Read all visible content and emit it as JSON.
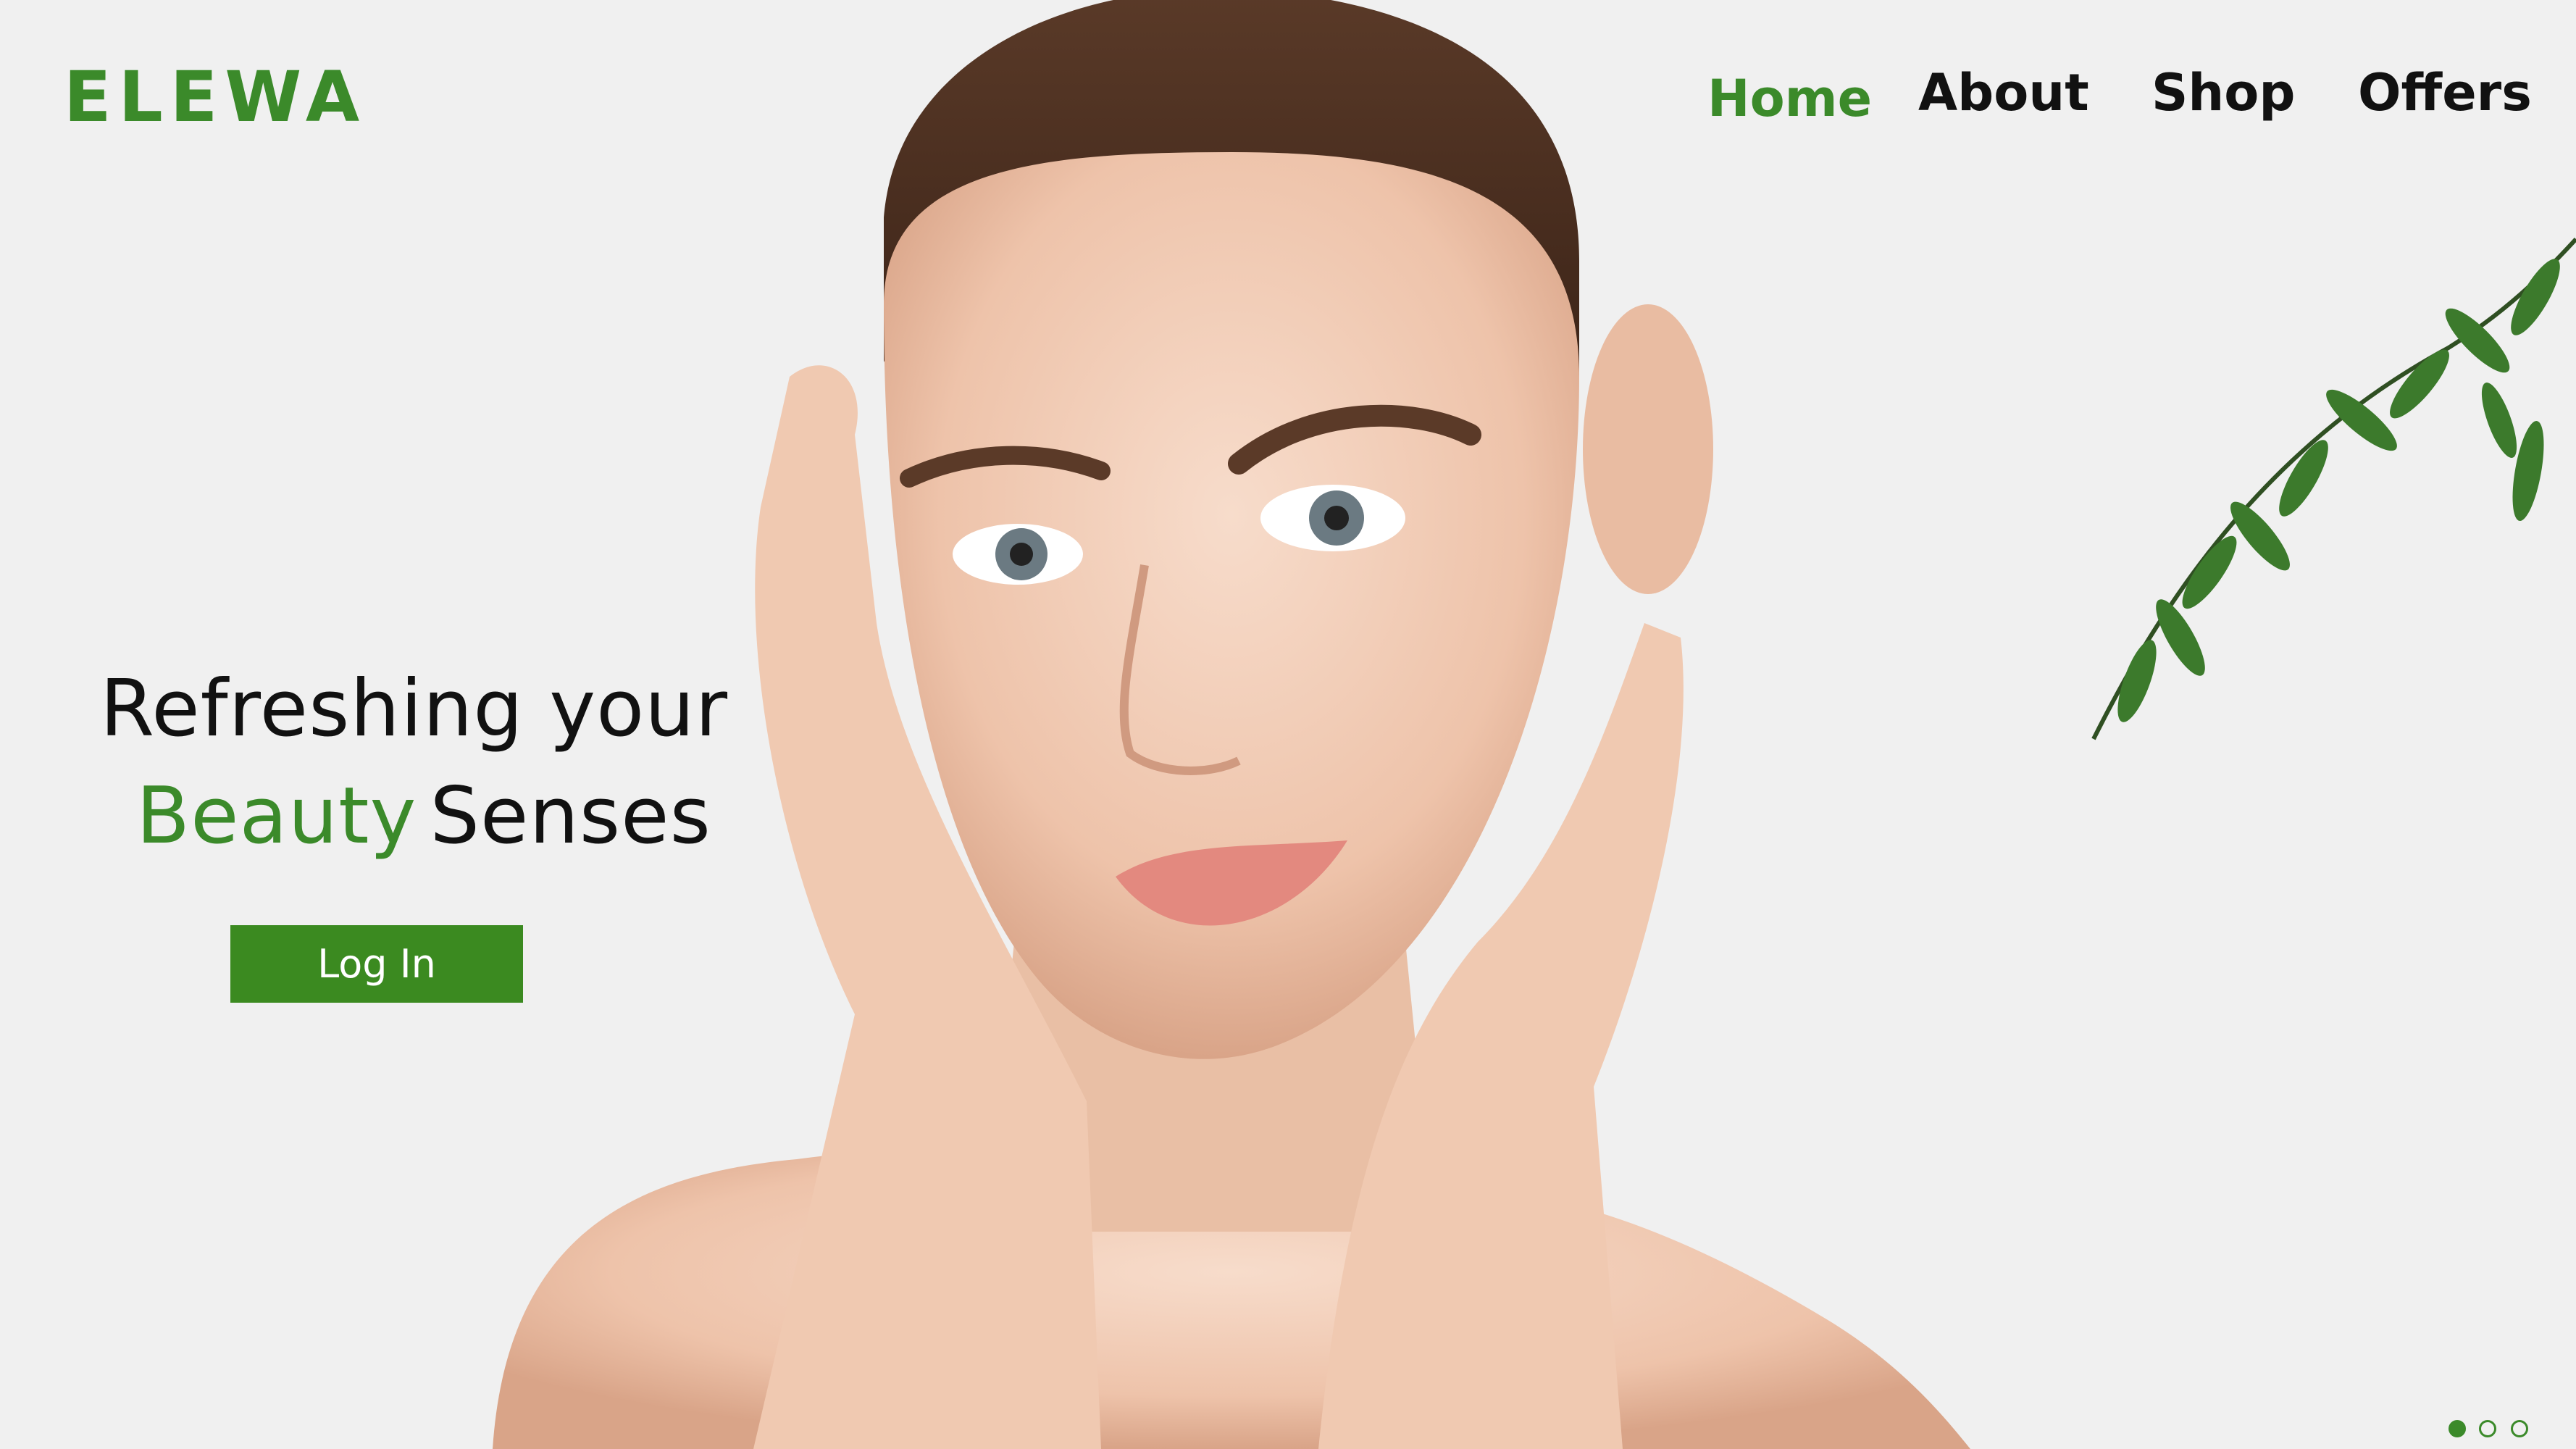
{
  "brand": {
    "logo_text": "ELEWA",
    "accent_color": "#3b8a2a"
  },
  "nav": {
    "items": [
      {
        "label": "Home",
        "active": true
      },
      {
        "label": "About",
        "active": false
      },
      {
        "label": "Shop",
        "active": false
      },
      {
        "label": "Offers",
        "active": false
      }
    ]
  },
  "hero": {
    "headline_line1": "Refreshing your",
    "headline_accent": "Beauty",
    "headline_rest": "Senses",
    "login_label": "Log In",
    "image_subject": "woman-face-portrait",
    "decoration": "green-leaf-branch"
  },
  "carousel": {
    "slides": 3,
    "active_index": 0
  }
}
